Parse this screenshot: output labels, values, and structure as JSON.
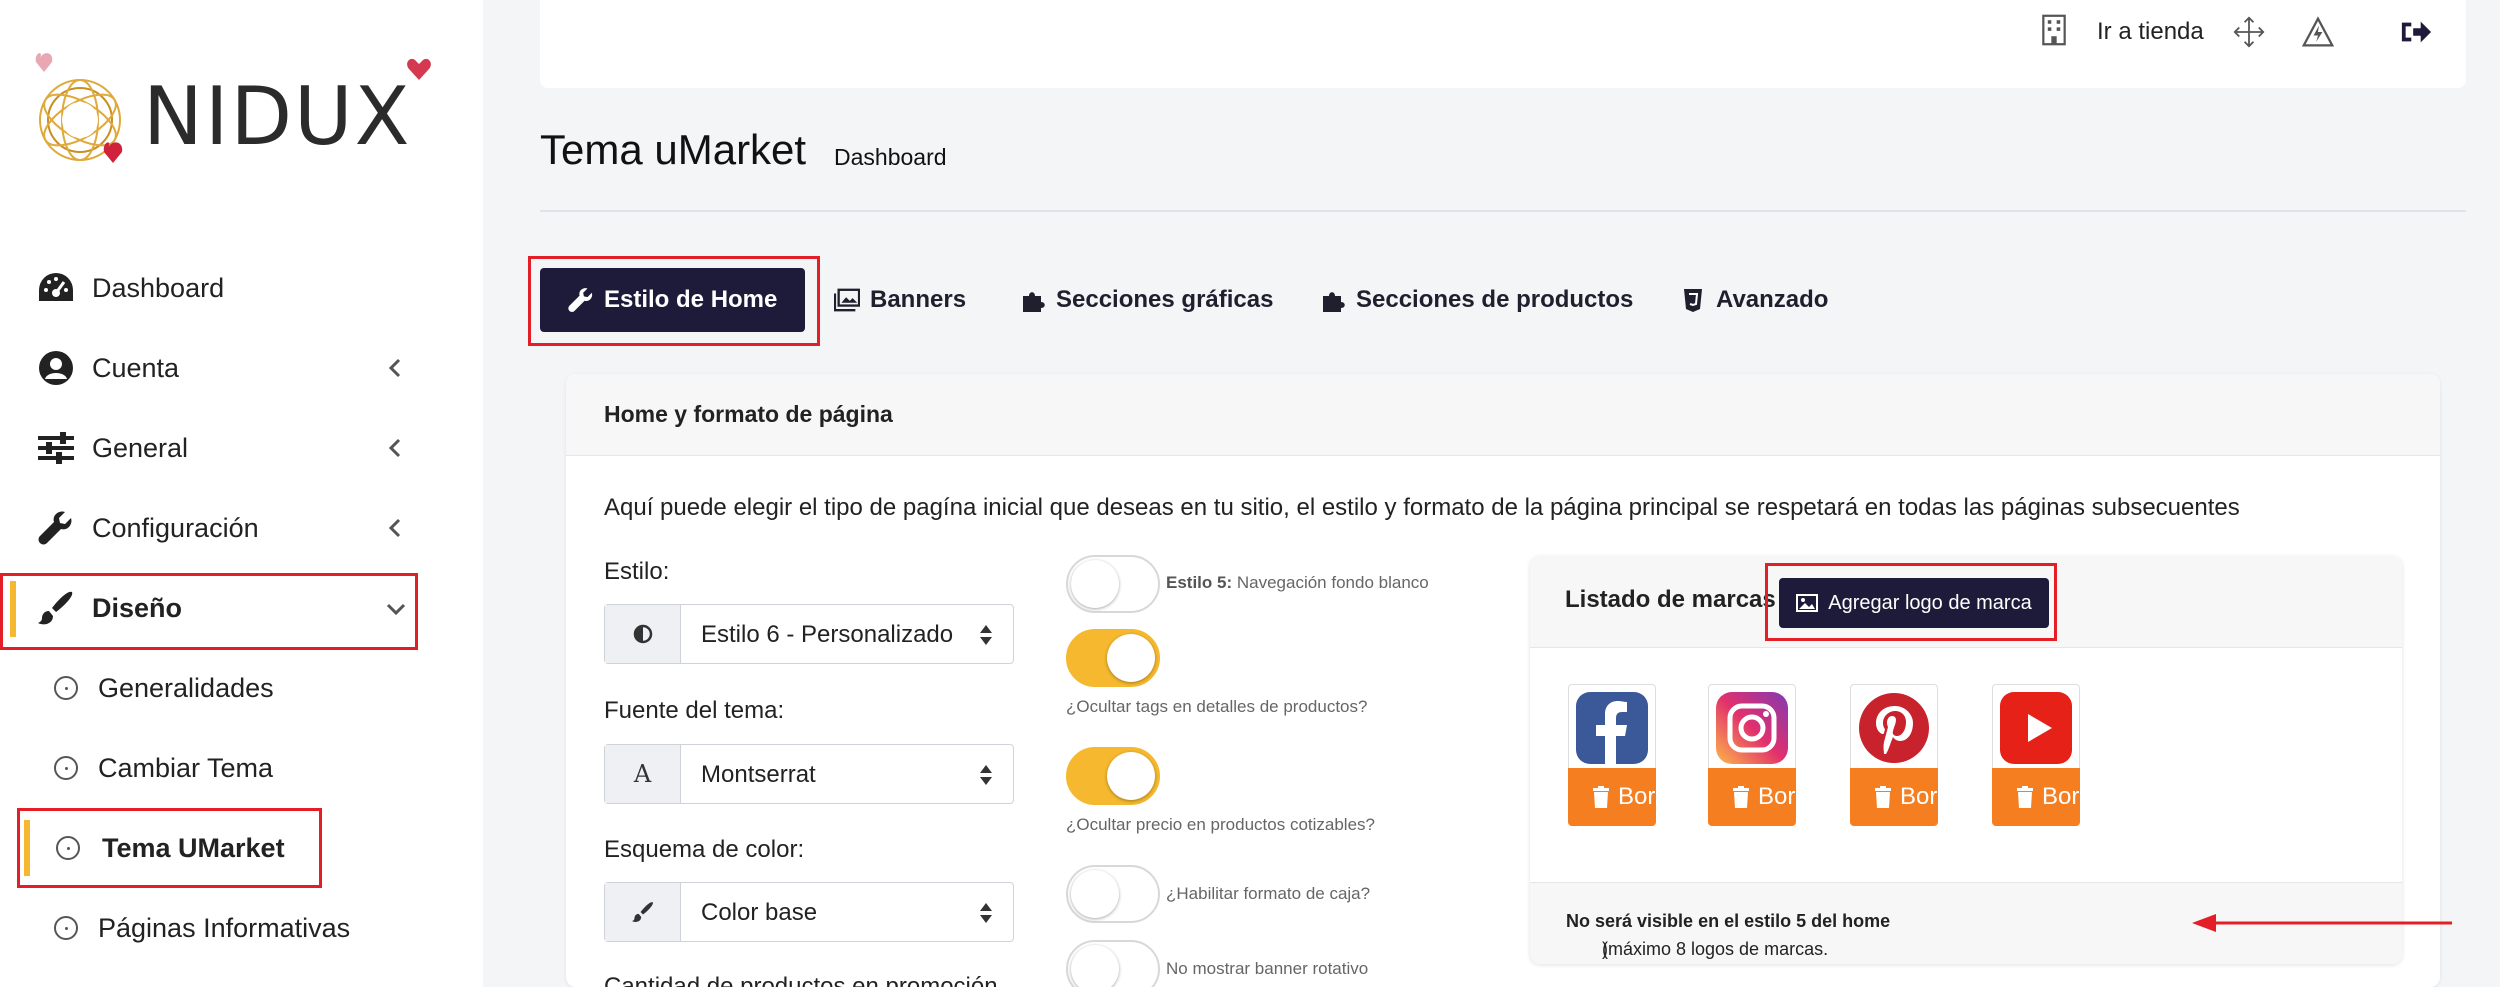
{
  "logo": {
    "text": "NIDUX"
  },
  "sidebar": {
    "items": [
      {
        "label": "Dashboard",
        "icon": "dashboard-icon"
      },
      {
        "label": "Cuenta",
        "icon": "account-icon"
      },
      {
        "label": "General",
        "icon": "sliders-icon"
      },
      {
        "label": "Configuración",
        "icon": "wrench-icon"
      },
      {
        "label": "Diseño",
        "icon": "brush-icon"
      }
    ],
    "subitems": [
      {
        "label": "Generalidades"
      },
      {
        "label": "Cambiar Tema"
      },
      {
        "label": "Tema UMarket"
      },
      {
        "label": "Páginas Informativas"
      }
    ]
  },
  "header": {
    "store_link": "Ir a tienda"
  },
  "page": {
    "title": "Tema uMarket",
    "subtitle": "Dashboard"
  },
  "tabs": [
    {
      "label": "Estilo de Home"
    },
    {
      "label": "Banners"
    },
    {
      "label": "Secciones gráficas"
    },
    {
      "label": "Secciones de productos"
    },
    {
      "label": "Avanzado"
    }
  ],
  "card": {
    "title": "Home y formato de página",
    "intro": "Aquí puede elegir el tipo de pagína inicial que deseas en tu sitio, el estilo y formato de la página principal se respetará en todas las páginas subsecuentes"
  },
  "form": {
    "style_label": "Estilo:",
    "style_value": "Estilo 6 - Personalizado",
    "font_label": "Fuente del tema:",
    "font_value": "Montserrat",
    "font_addon": "A",
    "color_label": "Esquema de color:",
    "color_value": "Color base",
    "promo_label": "Cantidad de productos en promoción"
  },
  "toggles": [
    {
      "bold": "Estilo 5:",
      "label": "Navegación fondo blanco",
      "on": false
    },
    {
      "label": "¿Ocultar tags en detalles de productos?",
      "on": true
    },
    {
      "label": "¿Ocultar precio en productos cotizables?",
      "on": true
    },
    {
      "label": "¿Habilitar formato de caja?",
      "on": false
    },
    {
      "label": "No mostrar banner rotativo",
      "on": false
    }
  ],
  "brands": {
    "title": "Listado de marcas",
    "add_button": "Agregar logo de marca",
    "delete_label": "Borrar",
    "items": [
      {
        "name": "Facebook",
        "color": "#3b5998"
      },
      {
        "name": "Instagram",
        "color": "#d6249f"
      },
      {
        "name": "Pinterest",
        "color": "#c8232c"
      },
      {
        "name": "YouTube",
        "color": "#e62117"
      }
    ],
    "footer_prefix": "(máximo 8 logos de marcas. ",
    "footer_bold": "No será visible en el estilo 5 del home",
    "footer_suffix": ")"
  },
  "colors": {
    "primary": "#1e1b3a",
    "accent": "#f5b82e",
    "danger": "#f57f20",
    "highlight": "#e41e26"
  }
}
